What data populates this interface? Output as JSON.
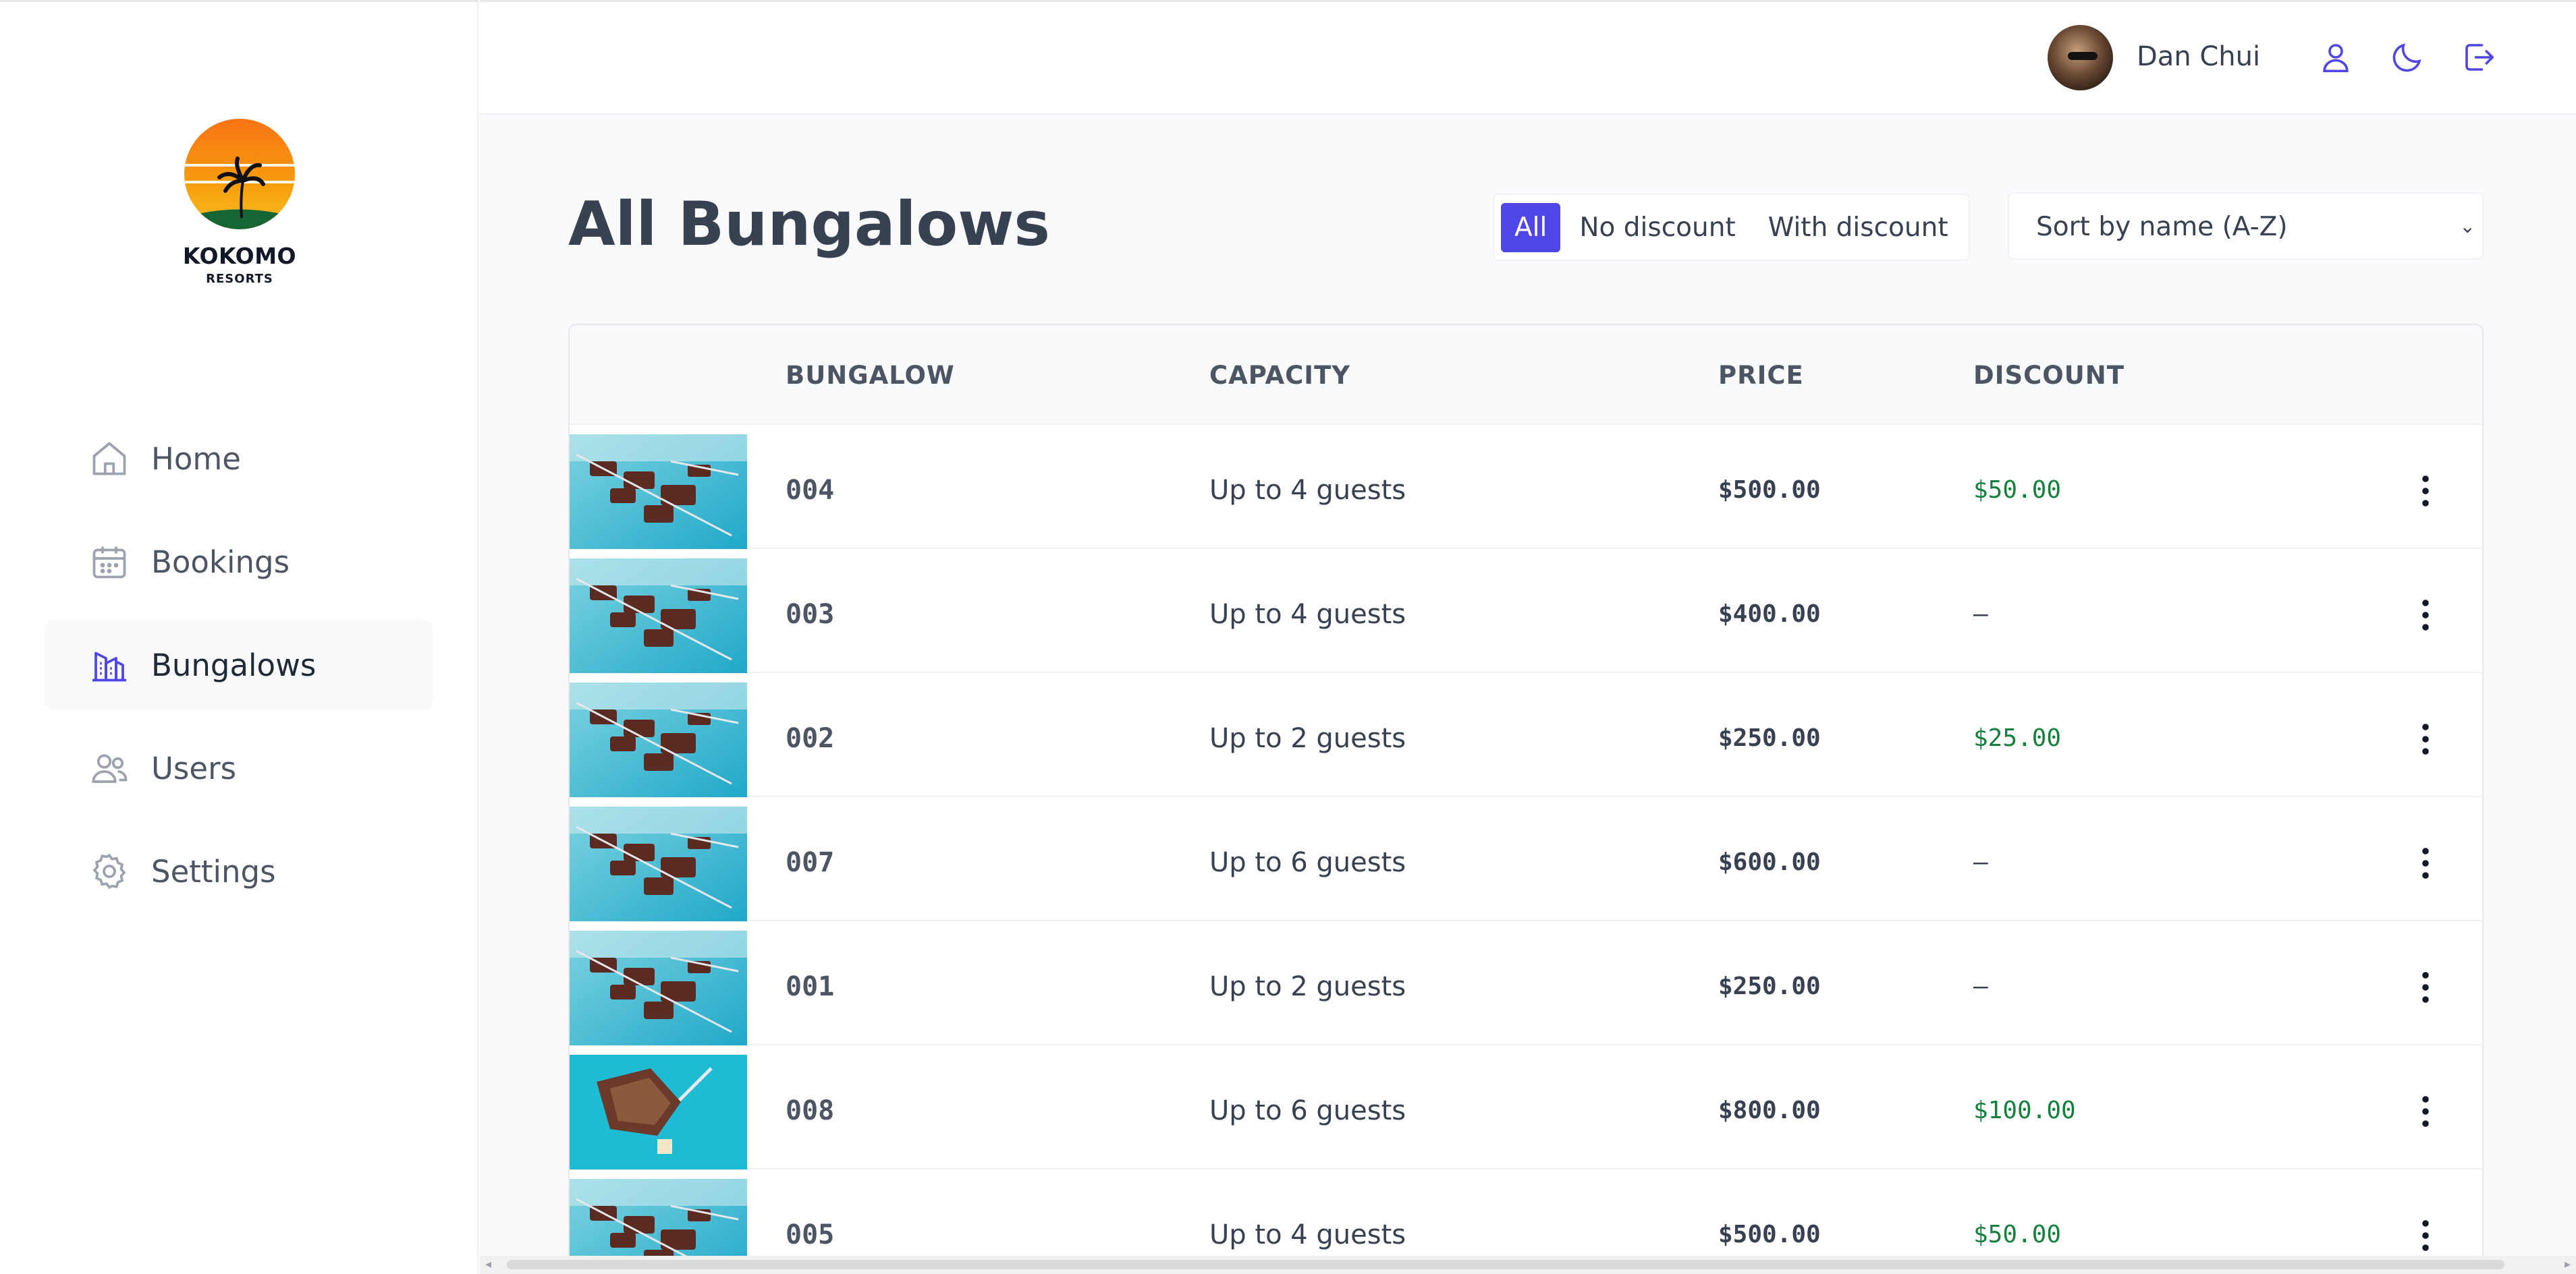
{
  "brand": {
    "name": "KOKOMO",
    "sub": "RESORTS",
    "colors": {
      "sun_top": "#f59e0b",
      "sun_bottom": "#fbbf24",
      "ground": "#166534"
    }
  },
  "sidebar": {
    "items": [
      {
        "label": "Home",
        "icon": "home-icon",
        "active": false
      },
      {
        "label": "Bookings",
        "icon": "calendar-icon",
        "active": false
      },
      {
        "label": "Bungalows",
        "icon": "building-icon",
        "active": true
      },
      {
        "label": "Users",
        "icon": "users-icon",
        "active": false
      },
      {
        "label": "Settings",
        "icon": "gear-icon",
        "active": false
      }
    ]
  },
  "header": {
    "username": "Dan Chui",
    "buttons": [
      "user-icon",
      "moon-icon",
      "logout-icon"
    ],
    "accent": "#4f46e5"
  },
  "page": {
    "title": "All Bungalows",
    "filters": [
      "All",
      "No discount",
      "With discount"
    ],
    "active_filter": "All",
    "sort": {
      "selected": "Sort by name (A-Z)"
    }
  },
  "table": {
    "headers": {
      "image": "",
      "bungalow": "BUNGALOW",
      "capacity": "CAPACITY",
      "price": "PRICE",
      "discount": "DISCOUNT"
    },
    "rows": [
      {
        "name": "004",
        "capacity": "Up to 4 guests",
        "price": "$500.00",
        "discount": "$50.00"
      },
      {
        "name": "003",
        "capacity": "Up to 4 guests",
        "price": "$400.00",
        "discount": "—"
      },
      {
        "name": "002",
        "capacity": "Up to 2 guests",
        "price": "$250.00",
        "discount": "$25.00"
      },
      {
        "name": "007",
        "capacity": "Up to 6 guests",
        "price": "$600.00",
        "discount": "—"
      },
      {
        "name": "001",
        "capacity": "Up to 2 guests",
        "price": "$250.00",
        "discount": "—"
      },
      {
        "name": "008",
        "capacity": "Up to 6 guests",
        "price": "$800.00",
        "discount": "$100.00"
      },
      {
        "name": "005",
        "capacity": "Up to 4 guests",
        "price": "$500.00",
        "discount": "$50.00"
      }
    ],
    "discount_color": "#15803d"
  }
}
